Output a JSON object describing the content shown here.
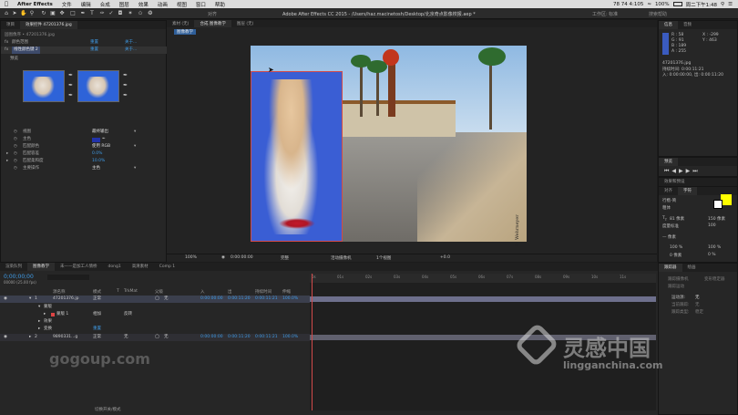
{
  "menubar": {
    "apple": "",
    "app": "After Effects",
    "items": [
      "文件",
      "编辑",
      "合成",
      "图层",
      "效果",
      "动画",
      "视图",
      "窗口",
      "帮助"
    ],
    "status": "78 74 4:105",
    "time": "周二下午1:48",
    "battery": "100%"
  },
  "toolbar": {
    "snap_label": "对齐",
    "doc_title": "Adobe After Effects CC 2015 - /Users/haz.macinetosh/Desktop/北京奇点影像校报.aep *",
    "workspace_label": "工作区:",
    "workspace_value": "标准",
    "search_placeholder": "搜索帮助"
  },
  "project_tabs": [
    "项目",
    "效果控件 47201376.jpg"
  ],
  "effect_controls": {
    "layer_title": "固图像序 • 47201376.jpg",
    "rows": [
      {
        "name": "颜色范围",
        "reset": "重置",
        "about": "关于..."
      },
      {
        "name": "线性颜色键 2",
        "reset": "重置",
        "about": "关于..."
      }
    ],
    "preview_label": "预览",
    "params": [
      {
        "name": "视图",
        "value": "最终输出"
      },
      {
        "name": "主色",
        "value": ""
      },
      {
        "name": "匹配颜色",
        "value": "使用 RGB"
      },
      {
        "name": "匹配容差",
        "value": "0.0%"
      },
      {
        "name": "匹配柔和度",
        "value": "10.0%"
      },
      {
        "name": "主要操作",
        "value": "主色"
      }
    ]
  },
  "comp_tabs": [
    "素材 (无)",
    "合成 图像教学",
    "图层 (无)"
  ],
  "comp_name": "图像教学",
  "viewer_footer": {
    "zoom": "100%",
    "timecode": "0:00:00:00",
    "resolution": "完整",
    "camera": "活动摄像机",
    "views": "1个视图",
    "exposure": "+0.0"
  },
  "image_signature": "R. Wehrneyer",
  "info_panel": {
    "tabs": [
      "信息",
      "音频"
    ],
    "r": "R : 58",
    "g": "G : 91",
    "b": "B : 189",
    "a": "A : 255",
    "x": "X : -299",
    "y": "Y : 463",
    "file": "47201376.jpg",
    "duration": "持续时间: 0:00:11:21",
    "inout": "入: 0:00:00:00, 出: 0:00:11:20"
  },
  "preview_panel": {
    "tab": "预览"
  },
  "effects_panel": {
    "tab": "效果和预设"
  },
  "char_panel": {
    "tabs": [
      "对齐",
      "字符"
    ],
    "font": "行楷-简",
    "style": "粗体",
    "size": "150 像素",
    "leading": "100",
    "tracking": "— 像素",
    "scale_v": "100 %",
    "scale_h": "100 %",
    "baseline": "0 像素",
    "tsume": "0 %"
  },
  "paragraph_panel": {
    "tabs": [
      "跟踪器",
      "绘画"
    ],
    "title": "跟踪摄像机",
    "row1": "变形稳定器",
    "row2": "跟踪运动",
    "motion_source_label": "运动源:",
    "motion_source": "无",
    "current_track_label": "当前跟踪:",
    "current_track": "无",
    "track_type_label": "跟踪类型:",
    "track_type": "稳定"
  },
  "timeline": {
    "tabs": [
      "渲染队列",
      "图像教学",
      "未——是加工人情桥",
      "dong1",
      "高清素材",
      "Comp 1"
    ],
    "timecode": "0;00;00;00",
    "fps": "00000 (25.00 fps)",
    "columns": [
      "源名称",
      "模式",
      "T",
      "TrkMat",
      "父级",
      "入",
      "出",
      "持续时间",
      "伸缩"
    ],
    "layers": [
      {
        "num": "1",
        "name": "47201376.jp",
        "mode": "正常",
        "trkmat": "",
        "parent": "无",
        "in": "0:00:00:00",
        "out": "0:00:11:20",
        "dur": "0:00:11:21",
        "stretch": "100.0%"
      },
      {
        "num": "2",
        "name": "9890331...g",
        "mode": "正常",
        "trkmat": "无",
        "parent": "无",
        "in": "0:00:00:00",
        "out": "0:00:11:20",
        "dur": "0:00:11:21",
        "stretch": "100.0%"
      }
    ],
    "sublayers": [
      "蒙版",
      "蒙版 1",
      "效果",
      "变换"
    ],
    "mask_mode": "相加",
    "mask_invert": "反转",
    "reset": "重置",
    "ruler": [
      "0s",
      "01s",
      "02s",
      "03s",
      "04s",
      "05s",
      "06s",
      "07s",
      "08s",
      "09s",
      "10s",
      "11s"
    ],
    "footer_label": "切换开关/模式"
  },
  "watermarks": {
    "left": "gogoup.com",
    "right_cn": "灵感中国",
    "right_url": "lingganchina.com"
  },
  "colors": {
    "accent": "#3f9be6",
    "key_blue": "#3a5ed4",
    "char_fill": "#ffff00"
  }
}
